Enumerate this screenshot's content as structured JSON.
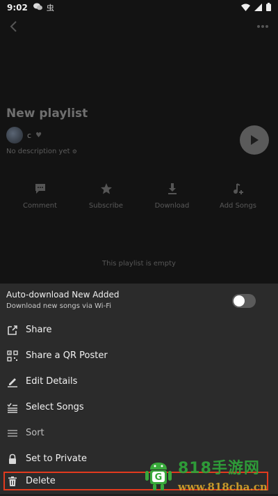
{
  "status": {
    "time": "9:02",
    "app_glyph": "虫"
  },
  "playlist": {
    "title": "New playlist",
    "owner": "c",
    "description": "No description yet",
    "empty_text": "This playlist is empty"
  },
  "actions": [
    {
      "label": "Comment",
      "icon": "comment-icon"
    },
    {
      "label": "Subscribe",
      "icon": "star-icon"
    },
    {
      "label": "Download",
      "icon": "download-icon"
    },
    {
      "label": "Add Songs",
      "icon": "add-songs-icon"
    }
  ],
  "sheet": {
    "auto_download_title": "Auto-download New Added",
    "auto_download_subtitle": "Download new songs via Wi-Fi",
    "auto_download_enabled": false,
    "items": [
      {
        "label": "Share",
        "icon": "share-icon"
      },
      {
        "label": "Share a QR Poster",
        "icon": "qr-code-icon"
      },
      {
        "label": "Edit Details",
        "icon": "pencil-icon"
      },
      {
        "label": "Select Songs",
        "icon": "checklist-icon"
      },
      {
        "label": "Sort",
        "icon": "sort-icon"
      },
      {
        "label": "Set to Private",
        "icon": "lock-icon"
      },
      {
        "label": "Delete",
        "icon": "trash-icon"
      }
    ]
  },
  "watermark": {
    "top": "818手游网",
    "bottom": "www.818cha.cn"
  },
  "colors": {
    "sheet_background": "#2b2b2b",
    "highlight_border": "#e23a1e"
  }
}
